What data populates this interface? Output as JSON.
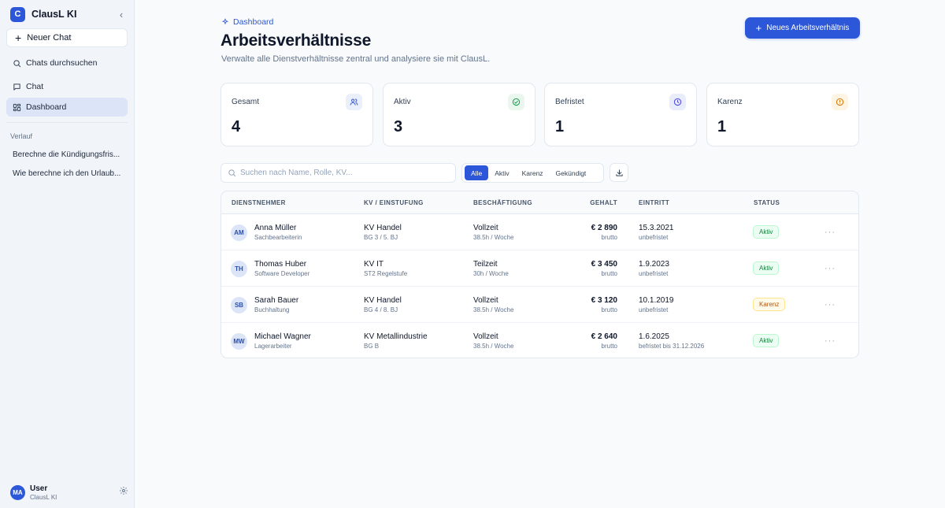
{
  "sidebar": {
    "brand_letter": "C",
    "brand_name": "ClausL KI",
    "collapse_icon": "chevron-left-icon",
    "new_chat_label": "Neuer Chat",
    "nav": [
      {
        "label": "Chats durchsuchen",
        "icon": "search-icon"
      },
      {
        "label": "Chat",
        "icon": "message-square-icon"
      },
      {
        "label": "Dashboard",
        "icon": "layout-grid-icon",
        "active": true
      }
    ],
    "history_label": "Verlauf",
    "history": [
      {
        "label": "Berechne die Kündigungsfris..."
      },
      {
        "label": "Wie berechne ich den Urlaub..."
      }
    ],
    "user": {
      "initials": "MA",
      "name": "User",
      "subtitle": "ClausL KI"
    }
  },
  "header": {
    "breadcrumb": "Dashboard",
    "title": "Arbeitsverhältnisse",
    "subtitle": "Verwalte alle Dienstverhältnisse zentral und analysiere sie mit ClausL.",
    "new_button_label": "Neues Arbeitsverhältnis"
  },
  "stats": [
    {
      "label": "Gesamt",
      "value": "4",
      "icon": "users-icon",
      "icon_color": "#3b5bdb",
      "icon_bg": "#eaf0fb"
    },
    {
      "label": "Aktiv",
      "value": "3",
      "icon": "check-circle-icon",
      "icon_color": "#16a34a",
      "icon_bg": "#eaf7ef"
    },
    {
      "label": "Befristet",
      "value": "1",
      "icon": "clock-icon",
      "icon_color": "#4f46e5",
      "icon_bg": "#e9ecfb"
    },
    {
      "label": "Karenz",
      "value": "1",
      "icon": "alert-circle-icon",
      "icon_color": "#d97706",
      "icon_bg": "#fdf4e3"
    }
  ],
  "toolbar": {
    "search_placeholder": "Suchen nach Name, Rolle, KV...",
    "filters": [
      {
        "label": "Alle",
        "active": true
      },
      {
        "label": "Aktiv"
      },
      {
        "label": "Karenz"
      },
      {
        "label": "Gekündigt"
      }
    ],
    "export_icon": "download-icon"
  },
  "table": {
    "columns": {
      "employee": "DIENSTNEHMER",
      "kv": "KV / EINSTUFUNG",
      "employment": "BESCHÄFTIGUNG",
      "salary": "GEHALT",
      "entry": "EINTRITT",
      "status": "STATUS"
    },
    "rows": [
      {
        "initials": "AM",
        "name": "Anna Müller",
        "role": "Sachbearbeiterin",
        "kv": "KV Handel",
        "grade": "BG 3 / 5. BJ",
        "type": "Vollzeit",
        "hours": "38.5h / Woche",
        "salary": "€ 2 890",
        "salary_note": "brutto",
        "entry": "15.3.2021",
        "term": "unbefristet",
        "status": "Aktiv",
        "status_kind": "aktiv"
      },
      {
        "initials": "TH",
        "name": "Thomas Huber",
        "role": "Software Developer",
        "kv": "KV IT",
        "grade": "ST2 Regelstufe",
        "type": "Teilzeit",
        "hours": "30h / Woche",
        "salary": "€ 3 450",
        "salary_note": "brutto",
        "entry": "1.9.2023",
        "term": "unbefristet",
        "status": "Aktiv",
        "status_kind": "aktiv"
      },
      {
        "initials": "SB",
        "name": "Sarah Bauer",
        "role": "Buchhaltung",
        "kv": "KV Handel",
        "grade": "BG 4 / 8. BJ",
        "type": "Vollzeit",
        "hours": "38.5h / Woche",
        "salary": "€ 3 120",
        "salary_note": "brutto",
        "entry": "10.1.2019",
        "term": "unbefristet",
        "status": "Karenz",
        "status_kind": "karenz"
      },
      {
        "initials": "MW",
        "name": "Michael Wagner",
        "role": "Lagerarbeiter",
        "kv": "KV Metallindustrie",
        "grade": "BG B",
        "type": "Vollzeit",
        "hours": "38.5h / Woche",
        "salary": "€ 2 640",
        "salary_note": "brutto",
        "entry": "1.6.2025",
        "term": "befristet bis 31.12.2026",
        "status": "Aktiv",
        "status_kind": "aktiv"
      }
    ],
    "row_action_icon": "more-horizontal-icon"
  },
  "colors": {
    "accent": "#2c57d8"
  }
}
